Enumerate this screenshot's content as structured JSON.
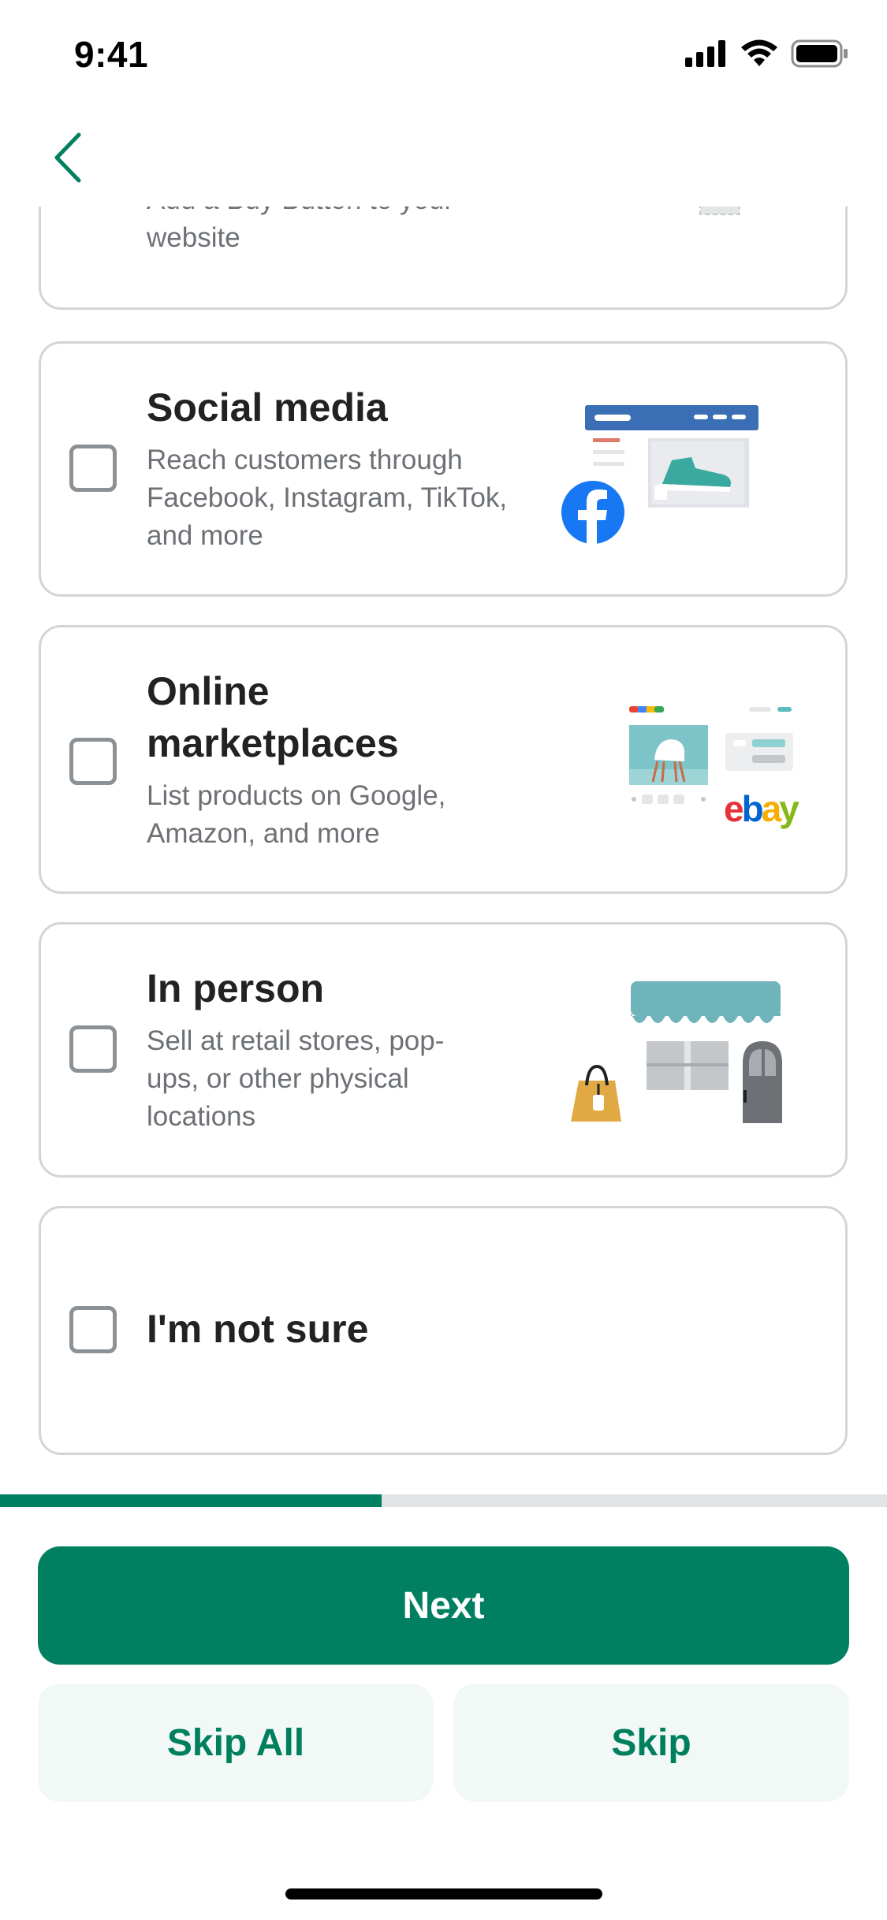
{
  "status_bar": {
    "time": "9:41"
  },
  "nav": {
    "back_icon": "chevron-left-icon"
  },
  "options": [
    {
      "id": "buy-button",
      "title": "",
      "description": "Add a Buy Button to your website",
      "checked": false
    },
    {
      "id": "social-media",
      "title": "Social media",
      "description": "Reach customers through Facebook, Instagram, TikTok, and more",
      "checked": false
    },
    {
      "id": "online-marketplaces",
      "title": "Online marketplaces",
      "description": "List products on Google, Amazon, and more",
      "checked": false,
      "illustration_logo": "ebay"
    },
    {
      "id": "in-person",
      "title": "In person",
      "description": "Sell at retail stores, pop-ups, or other physical locations",
      "checked": false
    },
    {
      "id": "not-sure",
      "title": "I'm not sure",
      "description": "",
      "checked": false
    }
  ],
  "progress": {
    "fraction": 0.43
  },
  "actions": {
    "next_label": "Next",
    "skip_all_label": "Skip All",
    "skip_label": "Skip"
  },
  "colors": {
    "accent": "#008060",
    "secondary_bg": "#f1f8f5",
    "secondary_text": "#007f5f",
    "track": "#e1e3e5"
  }
}
